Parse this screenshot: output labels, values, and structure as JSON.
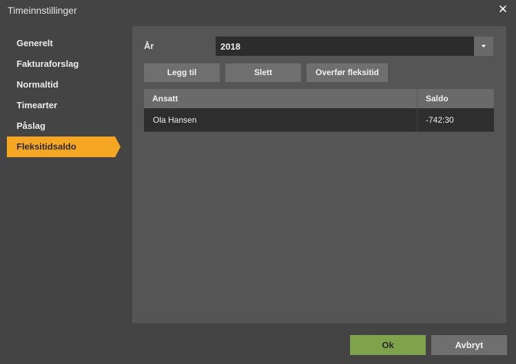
{
  "window": {
    "title": "Timeinnstillinger",
    "close_icon": "close-icon"
  },
  "sidebar": {
    "items": [
      {
        "label": "Generelt",
        "active": false
      },
      {
        "label": "Fakturaforslag",
        "active": false
      },
      {
        "label": "Normaltid",
        "active": false
      },
      {
        "label": "Timearter",
        "active": false
      },
      {
        "label": "Påslag",
        "active": false
      },
      {
        "label": "Fleksitidsaldo",
        "active": true
      }
    ]
  },
  "year": {
    "label": "År",
    "value": "2018"
  },
  "toolbar": {
    "add_label": "Legg til",
    "delete_label": "Slett",
    "transfer_label": "Overfør fleksitid"
  },
  "table": {
    "columns": [
      "Ansatt",
      "Saldo"
    ],
    "rows": [
      [
        "Ola Hansen",
        "-742:30"
      ]
    ]
  },
  "footer": {
    "ok_label": "Ok",
    "cancel_label": "Avbryt"
  },
  "colors": {
    "accent": "#f5a623",
    "ok": "#7ea34a",
    "panel": "#555555",
    "background": "#444444"
  }
}
